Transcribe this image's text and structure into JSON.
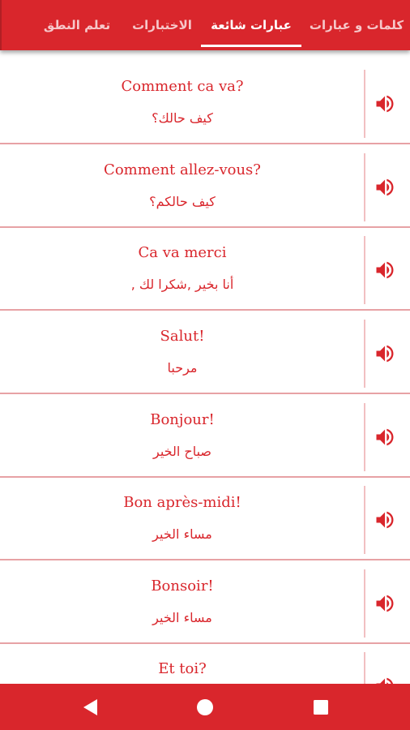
{
  "tabs": [
    {
      "label": "كلمات و عبارات",
      "active": false
    },
    {
      "label": "عبارات شائعة",
      "active": true
    },
    {
      "label": "الاختبارات",
      "active": false
    },
    {
      "label": "تعلم النطق",
      "active": false
    }
  ],
  "phrases": [
    {
      "french": "Comment ca va?",
      "arabic": "كيف حالك؟"
    },
    {
      "french": "Comment allez-vous?",
      "arabic": "كيف حالكم؟"
    },
    {
      "french": "Ca va merci",
      "arabic": "أنا بخير ,شكرا لك ,"
    },
    {
      "french": "Salut!",
      "arabic": "مرحبا"
    },
    {
      "french": "Bonjour!",
      "arabic": "صباح الخير"
    },
    {
      "french": "Bon après-midi!",
      "arabic": "مساء الخير"
    },
    {
      "french": "Bonsoir!",
      "arabic": "مساء الخير"
    },
    {
      "french": "Et toi?",
      "arabic": ""
    }
  ],
  "icons": {
    "play_audio": "volume-icon",
    "nav_back": "back-triangle-icon",
    "nav_home": "home-circle-icon",
    "nav_recents": "recents-square-icon"
  },
  "colors": {
    "accent": "#d9262c",
    "tab_inactive_text": "#f6c7c9",
    "row_separator": "#e7a2a5",
    "background": "#ffffff"
  }
}
